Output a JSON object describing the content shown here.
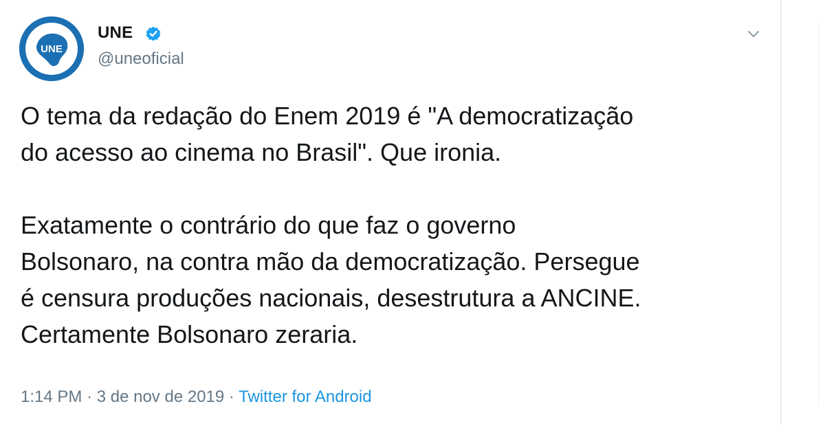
{
  "account": {
    "display_name": "UNE",
    "handle": "@uneoficial",
    "avatar_text": "UNE",
    "verified_icon": "verified-badge-icon"
  },
  "tweet": {
    "text": "O tema da redação do Enem 2019 é \"A democratização\ndo acesso ao cinema no Brasil\". Que ironia.\n\nExatamente o contrário do que faz o governo\nBolsonaro, na contra mão da democratização. Persegue\né censura produções nacionais, desestrutura a ANCINE.\nCertamente Bolsonaro zeraria.",
    "time": "1:14 PM",
    "separator": "·",
    "date": "3 de nov de 2019",
    "source": "Twitter for Android"
  },
  "icons": {
    "menu": "chevron-down-icon",
    "verified": "verified-badge-icon"
  },
  "colors": {
    "brand_blue": "#1b6fb3",
    "verified_blue": "#1da1f2",
    "text_primary": "#14171a",
    "text_secondary": "#657786",
    "link": "#1b95e0"
  }
}
